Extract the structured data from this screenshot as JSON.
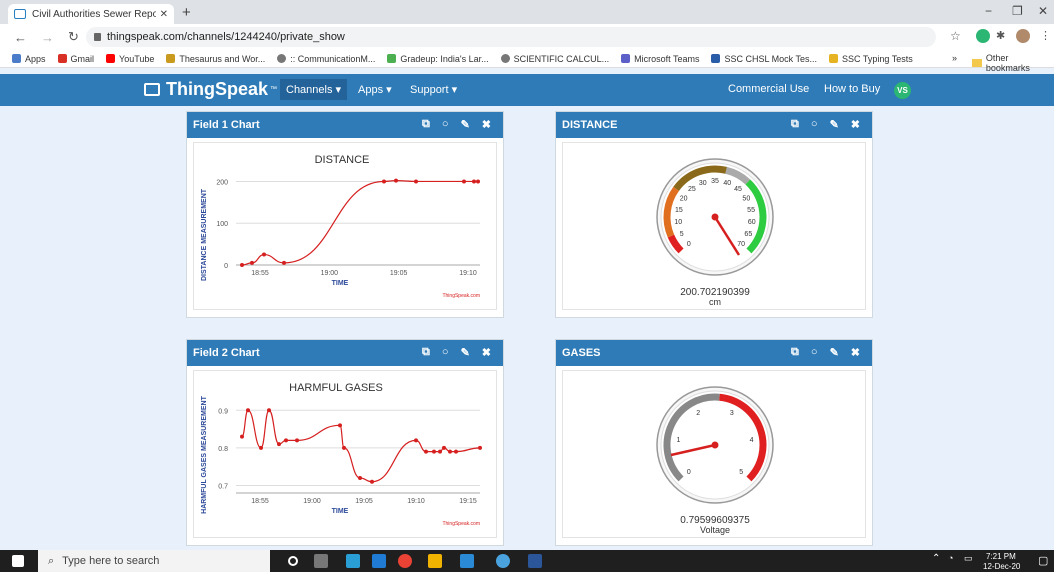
{
  "browser": {
    "tab_title": "Civil Authorities Sewer Report - T",
    "url": "thingspeak.com/channels/1244240/private_show",
    "bookmarks": [
      "Apps",
      "Gmail",
      "YouTube",
      "Thesaurus and Wor...",
      ":: CommunicationM...",
      "Gradeup: India's Lar...",
      "SCIENTIFIC CALCUL...",
      "Microsoft Teams",
      "SSC CHSL Mock Tes...",
      "SSC Typing Tests"
    ],
    "other_bookmarks": "Other bookmarks"
  },
  "header": {
    "logo": "ThingSpeak",
    "tm": "™",
    "nav": [
      "Channels ▾",
      "Apps ▾",
      "Support ▾"
    ],
    "right_nav": [
      "Commercial Use",
      "How to Buy"
    ],
    "avatar": "VS"
  },
  "panels": [
    {
      "title": "Field 1 Chart"
    },
    {
      "title": "DISTANCE"
    },
    {
      "title": "Field 2 Chart"
    },
    {
      "title": "GASES"
    }
  ],
  "chart_data": [
    {
      "type": "line",
      "title": "DISTANCE",
      "xlabel": "TIME",
      "ylabel": "DISTANCE MEASUREMENT",
      "x_ticks": [
        "18:55",
        "19:00",
        "19:05",
        "19:10"
      ],
      "y_ticks": [
        0,
        100,
        200
      ],
      "ylim": [
        0,
        225
      ],
      "x": [
        "18:52",
        "18:53",
        "18:54",
        "18:56",
        "19:03",
        "19:04",
        "19:06",
        "19:10",
        "19:11",
        "19:11.3"
      ],
      "values": [
        0,
        5,
        25,
        5,
        200,
        202,
        200,
        200,
        200,
        200
      ],
      "credit": "ThingSpeak.com",
      "color": "#d62020"
    },
    {
      "type": "line",
      "title": "HARMFUL GASES",
      "xlabel": "TIME",
      "ylabel": "HARMFUL GASES MEASUREMENT",
      "x_ticks": [
        "18:55",
        "19:00",
        "19:05",
        "19:10",
        "19:15"
      ],
      "y_ticks": [
        0.7,
        0.8,
        0.9
      ],
      "ylim": [
        0.68,
        0.93
      ],
      "values": [
        0.83,
        0.9,
        0.8,
        0.9,
        0.81,
        0.82,
        0.82,
        0.86,
        0.8,
        0.72,
        0.71,
        0.82,
        0.79,
        0.79,
        0.79,
        0.8,
        0.79,
        0.79,
        0.8
      ],
      "credit": "ThingSpeak.com",
      "color": "#d62020"
    }
  ],
  "gauges": [
    {
      "labels": [
        "0",
        "5",
        "10",
        "15",
        "20",
        "25",
        "30",
        "35",
        "40",
        "45",
        "50",
        "55",
        "60",
        "65",
        "70"
      ],
      "value": "200.702190399",
      "unit": "cm"
    },
    {
      "labels": [
        "0",
        "1",
        "2",
        "3",
        "4",
        "5"
      ],
      "value": "0.79599609375",
      "unit": "Voltage"
    }
  ],
  "taskbar": {
    "search_placeholder": "Type here to search",
    "time": "7:21 PM",
    "date": "12-Dec-20"
  }
}
